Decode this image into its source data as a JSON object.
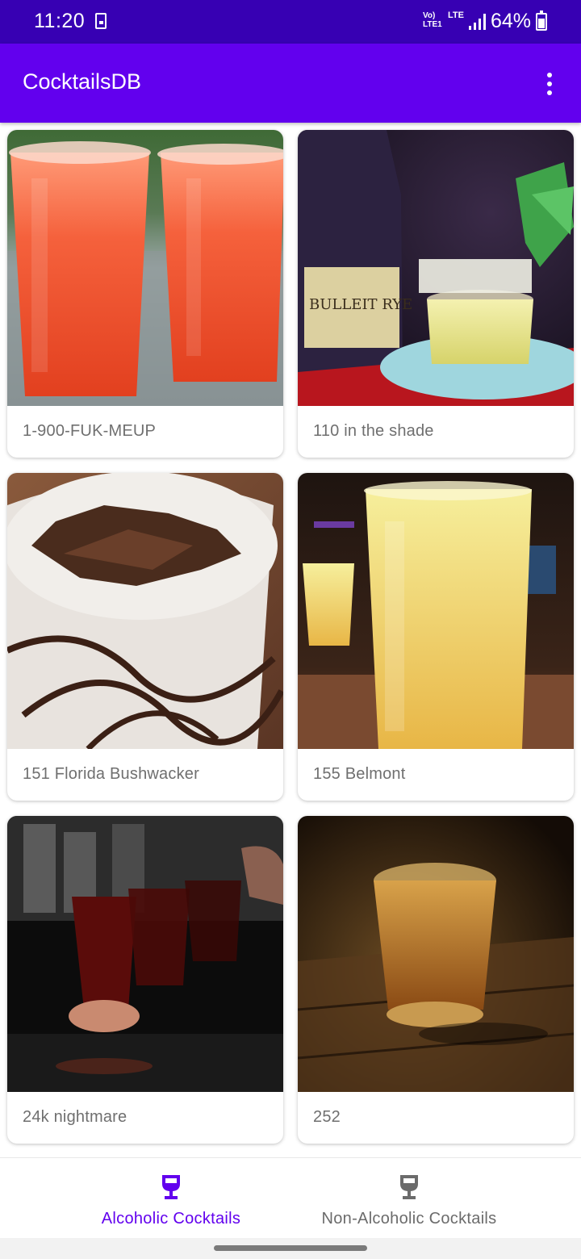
{
  "status_bar": {
    "time": "11:20",
    "network": "Vo) LTE\nLTE1 ↓↑",
    "lte": "LTE",
    "battery": "64%",
    "notification_icon": "sim-icon",
    "signal_icon": "signal-bars-icon",
    "battery_icon": "battery-icon"
  },
  "app_bar": {
    "title": "CocktailsDB",
    "overflow_icon": "more-vert-icon",
    "color": "#6200ee"
  },
  "cocktails": [
    {
      "name": "1-900-FUK-MEUP"
    },
    {
      "name": "110 in the shade"
    },
    {
      "name": "151 Florida Bushwacker"
    },
    {
      "name": "155 Belmont"
    },
    {
      "name": "24k nightmare"
    },
    {
      "name": "252"
    }
  ],
  "bottom_nav": {
    "items": [
      {
        "label": "Alcoholic Cocktails",
        "icon": "wine-glass-icon",
        "selected": true,
        "color": "#6200ee"
      },
      {
        "label": "Non-Alcoholic Cocktails",
        "icon": "wine-glass-icon",
        "selected": false,
        "color": "#6b6b6b"
      }
    ]
  }
}
